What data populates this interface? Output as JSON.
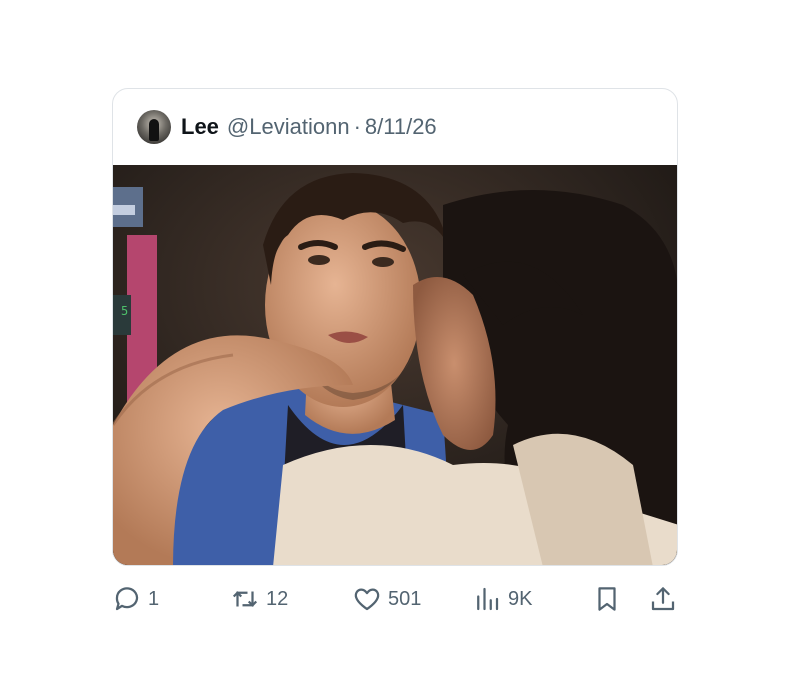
{
  "post": {
    "author_name": "Lee",
    "handle": "@Leviationn",
    "separator": "·",
    "date": "8/11/26",
    "media_alt": "photo",
    "media_overlay_text": "5"
  },
  "actions": {
    "replies": "1",
    "reposts": "12",
    "likes": "501",
    "views": "9K"
  },
  "icons": [
    "reply-icon",
    "repost-icon",
    "like-icon",
    "views-icon",
    "bookmark-icon",
    "share-icon"
  ],
  "colors": {
    "text_primary": "#0f1419",
    "text_secondary": "#536471",
    "border": "#dfe3e7"
  }
}
